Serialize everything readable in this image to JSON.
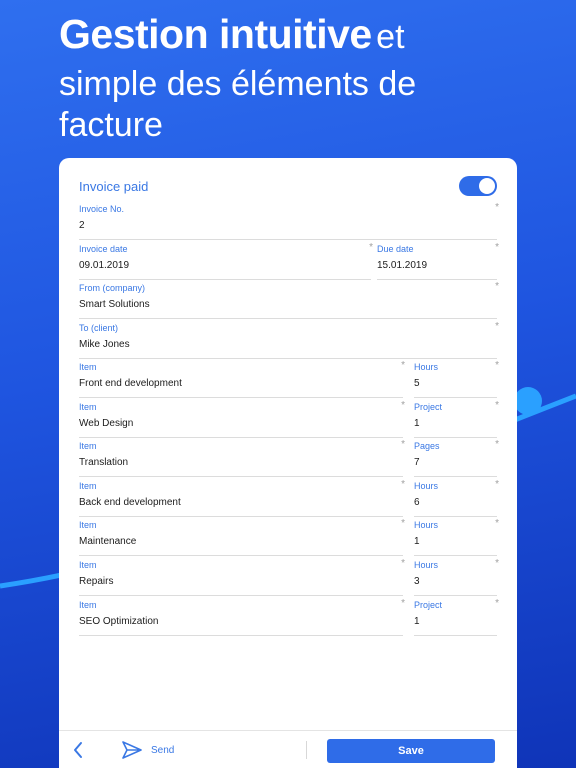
{
  "headline": {
    "line1_bold": "Gestion intuitive",
    "line1_light": "et",
    "line2": "simple des éléments de",
    "line3": "facture"
  },
  "form": {
    "invoice_paid_label": "Invoice paid",
    "invoice_paid_on": true,
    "required_mark": "*",
    "invoice_no": {
      "label": "Invoice No.",
      "value": "2"
    },
    "invoice_date": {
      "label": "Invoice date",
      "value": "09.01.2019"
    },
    "due_date": {
      "label": "Due date",
      "value": "15.01.2019"
    },
    "from": {
      "label": "From (company)",
      "value": "Smart Solutions"
    },
    "to": {
      "label": "To (client)",
      "value": "Mike Jones"
    },
    "items": [
      {
        "label": "Item",
        "name": "Front end development",
        "unit": "Hours",
        "qty": "5"
      },
      {
        "label": "Item",
        "name": "Web Design",
        "unit": "Project",
        "qty": "1"
      },
      {
        "label": "Item",
        "name": "Translation",
        "unit": "Pages",
        "qty": "7"
      },
      {
        "label": "Item",
        "name": "Back end development",
        "unit": "Hours",
        "qty": "6"
      },
      {
        "label": "Item",
        "name": "Maintenance",
        "unit": "Hours",
        "qty": "1"
      },
      {
        "label": "Item",
        "name": "Repairs",
        "unit": "Hours",
        "qty": "3"
      },
      {
        "label": "Item",
        "name": "SEO Optimization",
        "unit": "Project",
        "qty": "1"
      }
    ]
  },
  "footer": {
    "back_icon": "chevron-left-icon",
    "send_icon": "paper-plane-icon",
    "send_label": "Send",
    "save_label": "Save"
  },
  "colors": {
    "accent": "#2f6ce8",
    "label_blue": "#3a78e4",
    "background_top": "#2f6fef",
    "background_bottom": "#0f34b8"
  }
}
